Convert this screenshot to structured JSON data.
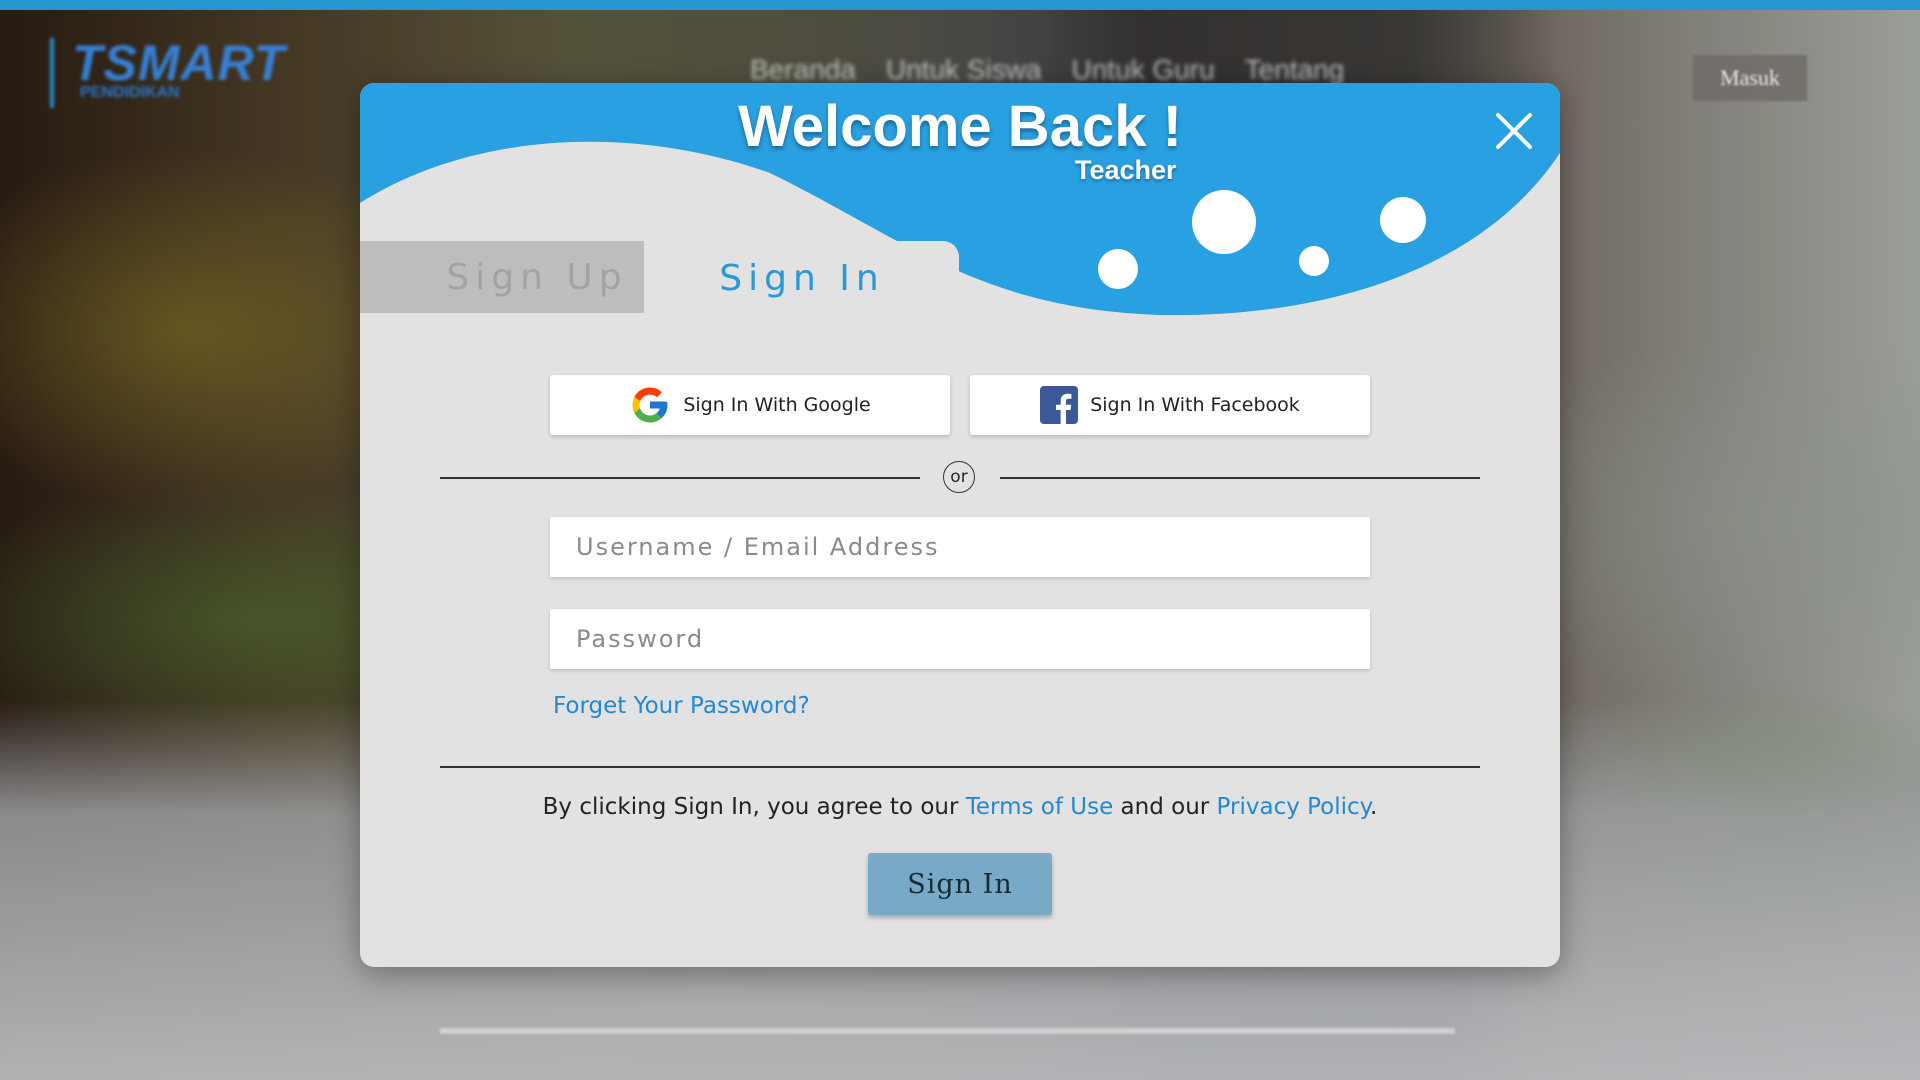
{
  "background": {
    "logo_text": "TSMART",
    "logo_subtext": "PENDIDIKAN",
    "nav": [
      "Beranda",
      "Untuk Siswa",
      "Untuk Guru",
      "Tentang"
    ],
    "login_button": "Masuk",
    "colors": {
      "top_bar": "#29a3e2"
    }
  },
  "modal": {
    "title": "Welcome Back !",
    "subtitle": "Teacher",
    "close_icon": "close-icon",
    "tabs": [
      {
        "label": "Sign Up",
        "active": false
      },
      {
        "label": "Sign In",
        "active": true
      }
    ],
    "social": {
      "google_label": "Sign In With Google",
      "facebook_label": "Sign In With Facebook"
    },
    "divider_text": "or",
    "fields": {
      "username_placeholder": "Username / Email Address",
      "username_value": "",
      "password_placeholder": "Password",
      "password_value": ""
    },
    "forgot_password": "Forget Your Password?",
    "agreement": {
      "prefix": "By clicking Sign In, you agree to our ",
      "terms": "Terms of Use",
      "middle": " and our ",
      "privacy": "Privacy Policy",
      "suffix": "."
    },
    "submit_label": "Sign In",
    "colors": {
      "header_blue": "#29a0e1",
      "modal_bg": "#e2e2e2",
      "link": "#2488d0",
      "button": "#78a9c6"
    }
  }
}
